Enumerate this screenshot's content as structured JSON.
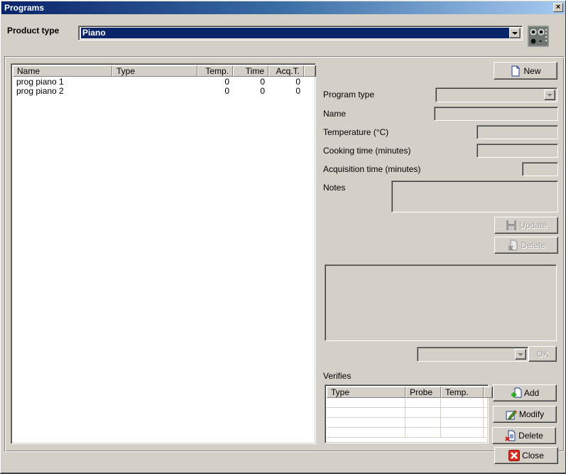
{
  "window": {
    "title": "Programs",
    "close_label": "×"
  },
  "product_type": {
    "label": "Product type",
    "selected": "Piano",
    "image_icon": "cooktop-icon"
  },
  "programs_list": {
    "columns": [
      "Name",
      "Type",
      "Temp.",
      "Time",
      "Acq.T."
    ],
    "rows": [
      {
        "name": "prog piano 1",
        "type": "",
        "temp": "0",
        "time": "0",
        "acq": "0"
      },
      {
        "name": "prog piano 2",
        "type": "",
        "temp": "0",
        "time": "0",
        "acq": "0"
      }
    ]
  },
  "form": {
    "new_button": "New",
    "program_type_label": "Program type",
    "program_type_value": "",
    "name_label": "Name",
    "name_value": "",
    "temperature_label": "Temperature (°C)",
    "temperature_value": "",
    "cooking_time_label": "Cooking time (minutes)",
    "cooking_time_value": "",
    "acquisition_time_label": "Acquisition time (minutes)",
    "acquisition_time_value": "",
    "notes_label": "Notes",
    "notes_value": "",
    "update_button": "Update",
    "delete_button": "Delete",
    "ok_button": "OK",
    "verify_select_value": ""
  },
  "verifies": {
    "label": "Verifies",
    "columns": [
      "Type",
      "Probe",
      "Temp."
    ],
    "rows": [],
    "add_button": "Add",
    "modify_button": "Modify",
    "delete_button": "Delete"
  },
  "footer": {
    "close_button": "Close"
  },
  "colors": {
    "title_start": "#0a246a",
    "title_end": "#a6caf0",
    "selection": "#0a246a",
    "face": "#d4d0c8"
  }
}
